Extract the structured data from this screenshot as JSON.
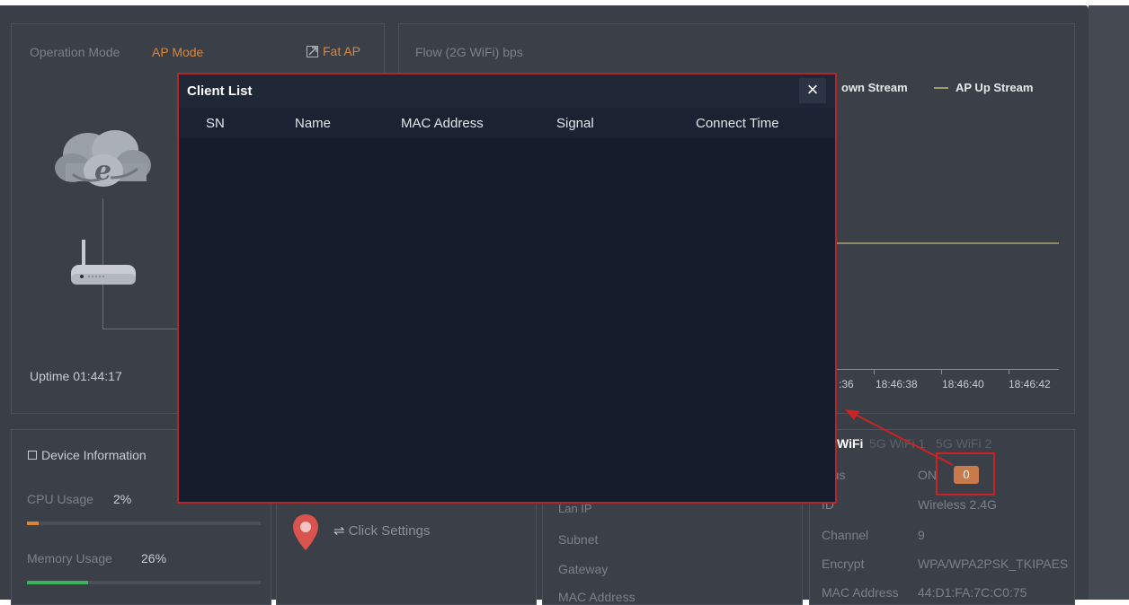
{
  "operation": {
    "label": "Operation Mode",
    "mode": "AP Mode",
    "fat_ap": "Fat AP",
    "uptime": "Uptime 01:44:17"
  },
  "flow": {
    "title": "Flow (2G WiFi) bps",
    "legend_down": "own Stream",
    "legend_up": "AP Up Stream",
    "ticks": [
      ":36",
      "18:46:38",
      "18:46:40",
      "18:46:42"
    ]
  },
  "device": {
    "title": "Device Information",
    "cpu_label": "CPU Usage",
    "cpu_value": "2%",
    "cpu_fraction": 0.02,
    "mem_label": "Memory Usage",
    "mem_value": "26%",
    "mem_fraction": 0.26
  },
  "location": {
    "settings": "Click Settings"
  },
  "lan": {
    "partial": "Lan IP",
    "subnet": "Subnet",
    "gateway": "Gateway",
    "mac": "MAC Address"
  },
  "wifi": {
    "tab_selected": "WiFi",
    "tab2": "5G WiFi 1",
    "tab3": "5G WiFi 2",
    "status_label": "atus",
    "status_value": "ON",
    "client_count": "0",
    "ssid_label": "ID",
    "ssid_value": "Wireless 2.4G",
    "channel_label": "Channel",
    "channel_value": "9",
    "encrypt_label": "Encrypt",
    "encrypt_value": "WPA/WPA2PSK_TKIPAES",
    "mac_label": "MAC Address",
    "mac_value": "44:D1:FA:7C:C0:75"
  },
  "modal": {
    "title": "Client List",
    "close": "×",
    "columns": [
      "SN",
      "Name",
      "MAC Address",
      "Signal",
      "Connect Time"
    ],
    "rows": []
  },
  "colors": {
    "accent": "#d9863a",
    "highlight_red": "#c22222",
    "memory_bar": "#3cb35a",
    "cpu_bar": "#d9863a"
  }
}
